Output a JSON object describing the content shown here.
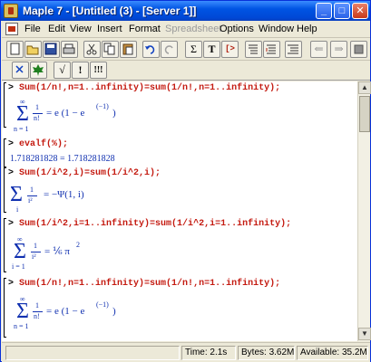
{
  "window": {
    "title": "Maple 7 - [Untitled (3) - [Server 1]]"
  },
  "title_buttons": {
    "minimize": "_",
    "maximize": "□",
    "close": "✕"
  },
  "menu": [
    {
      "label": "File",
      "enabled": true
    },
    {
      "label": "Edit",
      "enabled": true
    },
    {
      "label": "View",
      "enabled": true
    },
    {
      "label": "Insert",
      "enabled": true
    },
    {
      "label": "Format",
      "enabled": true
    },
    {
      "label": "Spreadsheet",
      "enabled": false
    },
    {
      "label": "Options",
      "enabled": true
    },
    {
      "label": "Window",
      "enabled": true
    },
    {
      "label": "Help",
      "enabled": true
    }
  ],
  "toolbar": {
    "sum_glyph": "Σ",
    "text_glyph": "T",
    "bracket_glyph": "[>",
    "back_glyph": "⇐",
    "forward_glyph": "⇒"
  },
  "toolbar2": {
    "sqrt_glyph": "√",
    "exclaim_glyph": "!",
    "exclaim3_glyph": "!!!"
  },
  "worksheet": {
    "prompt": ">",
    "input1": "Sum(1/n!,n=1..infinity)=sum(1/n!,n=1..infinity);",
    "output1": {
      "sigma": "Σ",
      "upper": "∞",
      "lower": "n = 1",
      "numerator": "1",
      "denominator": "n!",
      "rhs": "= e (1 − e",
      "exponent": "(−1)",
      "rhs_close": ")"
    },
    "input2": "evalf(%);",
    "output2": "1.718281828 = 1.718281828",
    "input3": "Sum(1/i^2,i)=sum(1/i^2,i);",
    "output3": {
      "sigma": "Σ",
      "lower": "i",
      "numerator": "1",
      "denominator": "i²",
      "rhs": "= −Ψ(1, i)"
    },
    "input4": "Sum(1/i^2,i=1..infinity)=sum(1/i^2,i=1..infinity);",
    "output4": {
      "sigma": "Σ",
      "upper": "∞",
      "lower": "i = 1",
      "numerator": "1",
      "denominator": "i²",
      "rhs": "= ⅙ π",
      "exponent": "2"
    },
    "input5": "Sum(1/n!,n=1..infinity)=sum(1/n!,n=1..infinity);",
    "output5": {
      "sigma": "Σ",
      "upper": "∞",
      "lower": "n = 1",
      "numerator": "1",
      "denominator": "n!",
      "rhs": "= e (1 − e",
      "exponent": "(−1)",
      "rhs_close": ")"
    }
  },
  "scroll_arrows": {
    "up": "▲",
    "down": "▼"
  },
  "status": {
    "time": "Time:  2.1s",
    "bytes": "Bytes: 3.62M",
    "available": "Available: 35.2M"
  }
}
